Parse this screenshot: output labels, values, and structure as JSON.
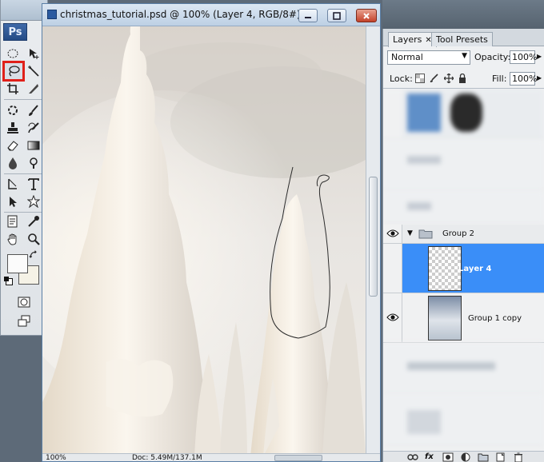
{
  "app": {
    "logo": "Ps"
  },
  "document": {
    "title": "christmas_tutorial.psd @ 100% (Layer 4, RGB/8#)",
    "status_zoom": "100%",
    "status_doc": "Doc: 5.49M/137.1M"
  },
  "tools": {
    "selected": "lasso-tool",
    "items": [
      "marquee-ellipse-tool",
      "move-tool",
      "lasso-tool",
      "magic-wand-tool",
      "crop-tool",
      "slice-tool",
      "healing-brush-tool",
      "brush-tool",
      "clone-stamp-tool",
      "history-brush-tool",
      "eraser-tool",
      "gradient-tool",
      "blur-tool",
      "dodge-tool",
      "pen-tool",
      "type-tool",
      "path-selection-tool",
      "custom-shape-tool",
      "notes-tool",
      "eyedropper-tool",
      "hand-tool",
      "zoom-tool"
    ],
    "foreground_color": "#fbfbfb",
    "background_color": "#f5f2e6"
  },
  "layers_panel": {
    "tabs": [
      {
        "label": "Layers",
        "active": true
      },
      {
        "label": "Tool Presets",
        "active": false
      }
    ],
    "blend_mode": "Normal",
    "opacity_label": "Opacity:",
    "opacity_value": "100%",
    "lock_label": "Lock:",
    "fill_label": "Fill:",
    "fill_value": "100%",
    "layers": [
      {
        "name": "Group 2",
        "type": "group",
        "visible": true,
        "active": false
      },
      {
        "name": "Layer 4",
        "type": "layer",
        "visible": false,
        "active": true
      },
      {
        "name": "Group 1 copy",
        "type": "layer",
        "visible": true,
        "active": false
      }
    ]
  },
  "colors": {
    "accent_selected_layer": "#3a8ef8",
    "tool_highlight": "#e0201a"
  }
}
